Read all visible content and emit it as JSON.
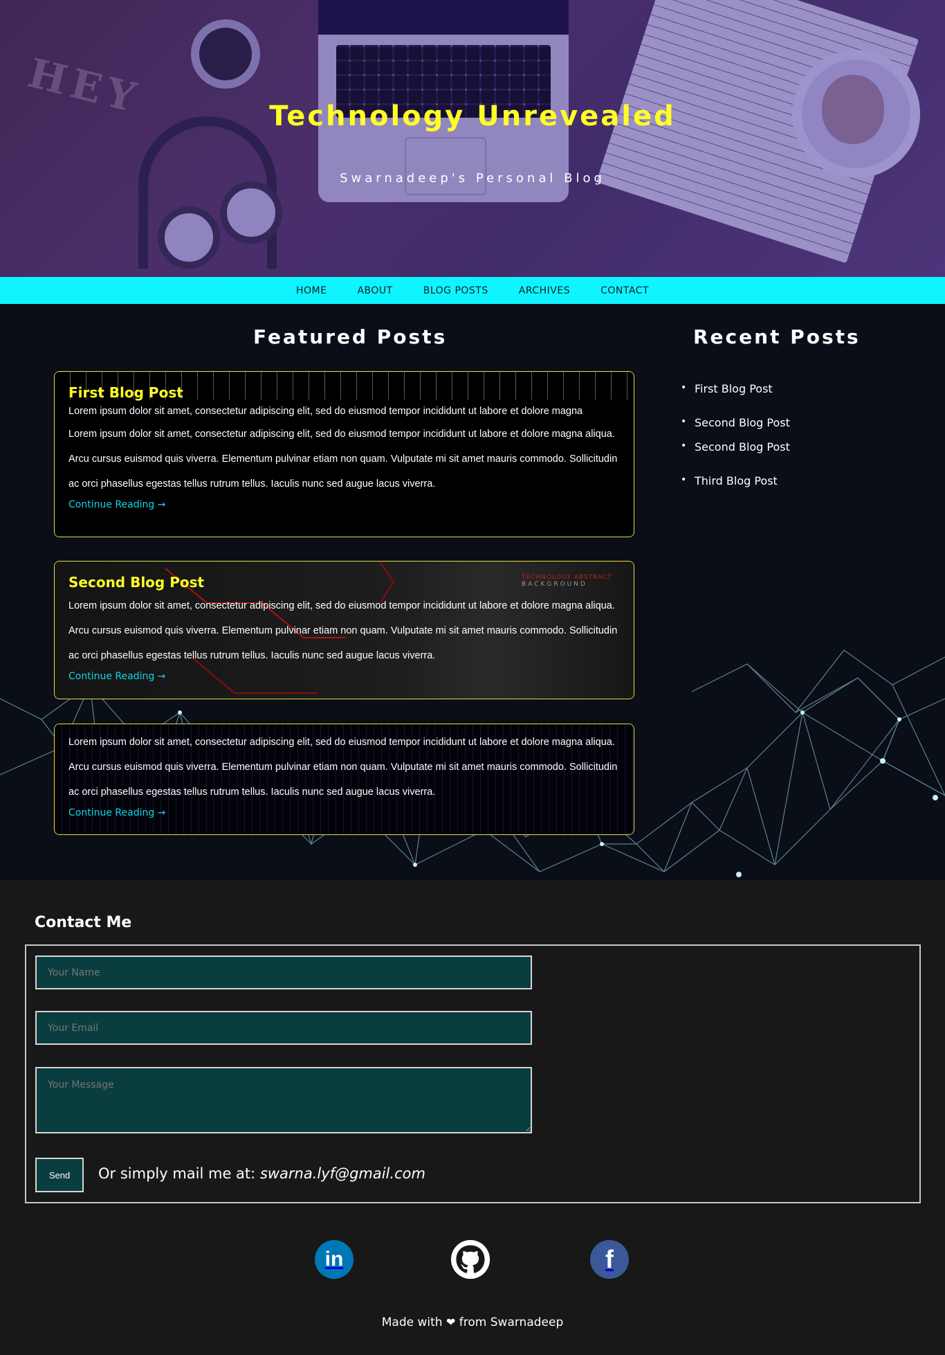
{
  "hero": {
    "title": "Technology Unrevealed",
    "subtitle": "Swarnadeep's Personal Blog",
    "decor_letters": "HEY"
  },
  "nav": {
    "items": [
      "HOME",
      "ABOUT",
      "BLOG POSTS",
      "ARCHIVES",
      "CONTACT"
    ]
  },
  "featured": {
    "heading": "Featured Posts",
    "posts": [
      {
        "title": "First Blog Post",
        "para1": "Lorem ipsum dolor sit amet, consectetur adipiscing elit, sed do eiusmod tempor incididunt ut labore et dolore magna",
        "para2": "Lorem ipsum dolor sit amet, consectetur adipiscing elit, sed do eiusmod tempor incididunt ut labore et dolore magna aliqua. Arcu cursus euismod quis viverra. Elementum pulvinar etiam non quam. Vulputate mi sit amet mauris commodo. Sollicitudin ac orci phasellus egestas tellus rutrum tellus. Iaculis nunc sed augue lacus viverra.",
        "more": "Continue Reading →"
      },
      {
        "title": "Second Blog Post",
        "para2": "Lorem ipsum dolor sit amet, consectetur adipiscing elit, sed do eiusmod tempor incididunt ut labore et dolore magna aliqua. Arcu cursus euismod quis viverra. Elementum pulvinar etiam non quam. Vulputate mi sit amet mauris commodo. Sollicitudin ac orci phasellus egestas tellus rutrum tellus. Iaculis nunc sed augue lacus viverra.",
        "more": "Continue Reading →",
        "bg_text_1": "TECHNOLOGY ABSTRACT",
        "bg_text_2": "BACKGROUND"
      },
      {
        "para2": "Lorem ipsum dolor sit amet, consectetur adipiscing elit, sed do eiusmod tempor incididunt ut labore et dolore magna aliqua. Arcu cursus euismod quis viverra. Elementum pulvinar etiam non quam. Vulputate mi sit amet mauris commodo. Sollicitudin ac orci phasellus egestas tellus rutrum tellus. Iaculis nunc sed augue lacus viverra.",
        "more": "Continue Reading →"
      }
    ]
  },
  "recent": {
    "heading": "Recent Posts",
    "items": [
      "First Blog Post",
      "Second Blog Post",
      "Second Blog Post",
      "Third Blog Post"
    ]
  },
  "contact": {
    "heading": "Contact Me",
    "name_placeholder": "Your Name",
    "email_placeholder": "Your Email",
    "message_placeholder": "Your Message",
    "send_label": "Send",
    "mail_prefix": "Or simply mail me at:",
    "mail_address": "swarna.lyf@gmail.com"
  },
  "social": {
    "icons": [
      "linkedin-icon",
      "github-icon",
      "facebook-icon"
    ],
    "linkedin_label": "in",
    "facebook_label": "f",
    "linkedin_color": "#0077b5",
    "facebook_color": "#3b5998"
  },
  "footer": {
    "prefix": "Made with",
    "suffix": "from Swarnadeep"
  },
  "colors": {
    "accent_yellow": "#ffff25",
    "nav_cyan": "#0ef5ff",
    "link_cyan": "#12d4e8",
    "field_teal": "#0a3d3f"
  }
}
